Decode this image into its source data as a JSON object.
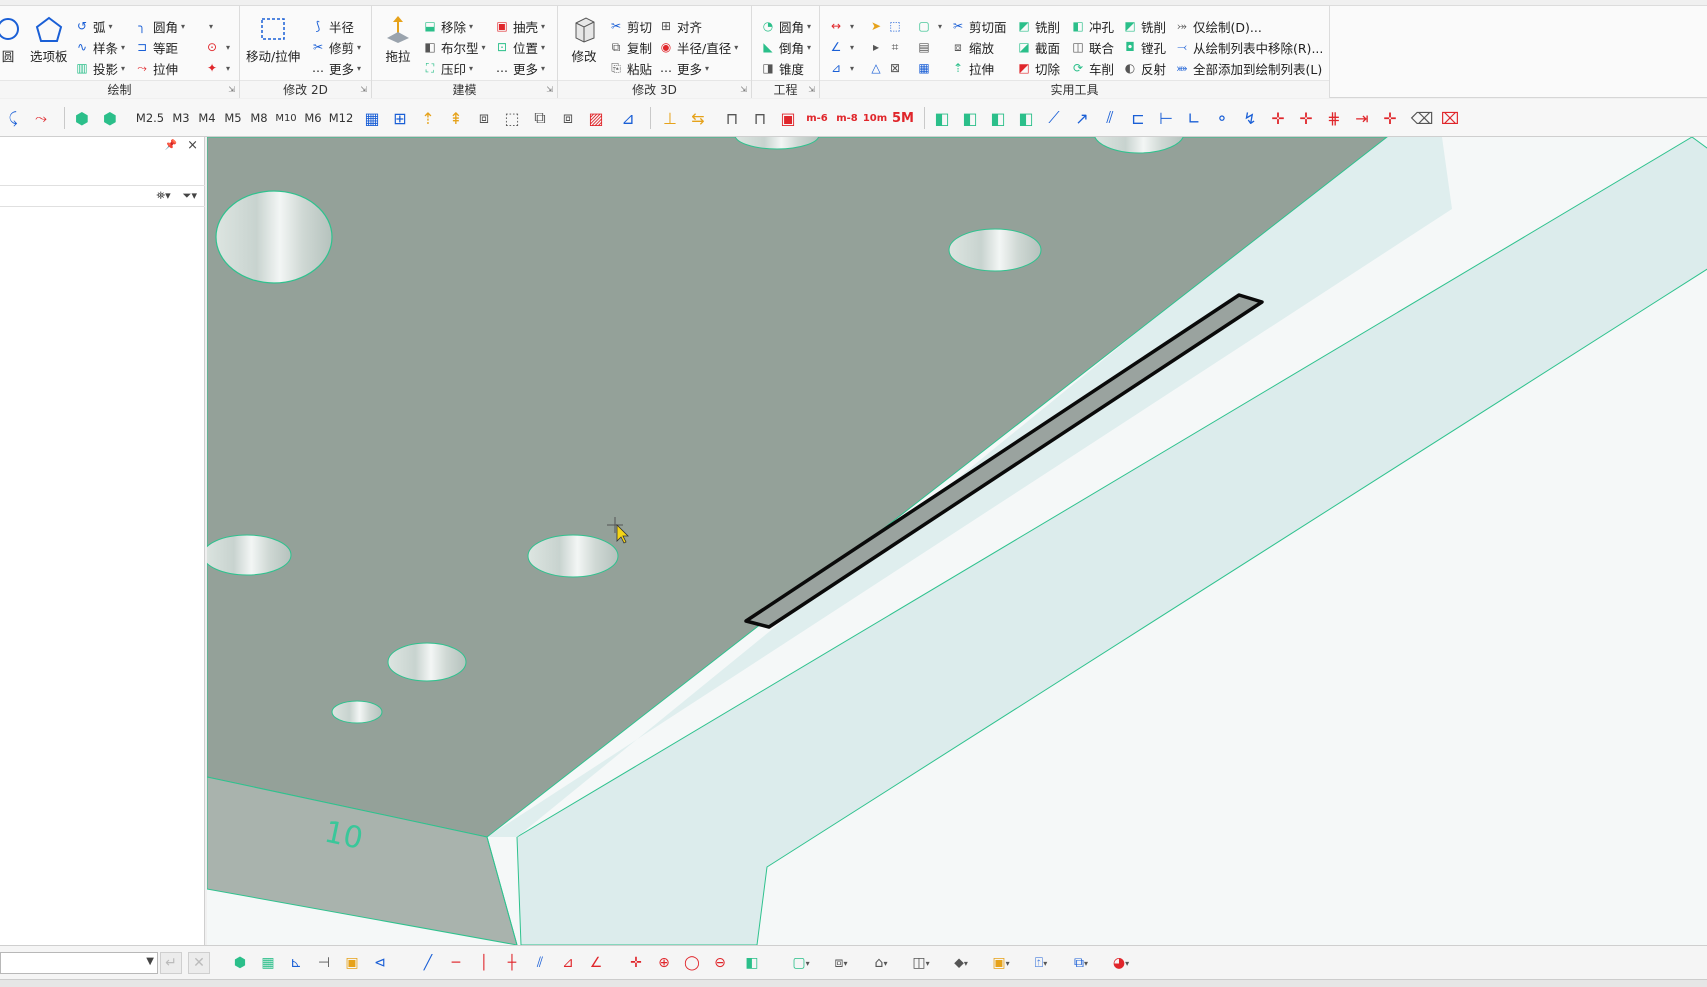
{
  "ribbon": {
    "groups": [
      {
        "title": "绘制"
      },
      {
        "title": "修改 2D"
      },
      {
        "title": "建模"
      },
      {
        "title": "修改 3D"
      },
      {
        "title": "工程"
      },
      {
        "title": "实用工具"
      }
    ],
    "draw": {
      "circle": "圆",
      "palette": "选项板",
      "arc": "弧",
      "spline": "样条",
      "project": "投影",
      "fillet": "圆角",
      "offset": "等距",
      "stretch": "拉伸"
    },
    "modify2d": {
      "move_stretch": "移动/拉伸",
      "radius": "半径",
      "trim": "修剪",
      "more": "更多"
    },
    "modeling": {
      "pull": "拖拉",
      "move": "移除",
      "boolean": "布尔型",
      "imprint": "压印",
      "shell": "抽壳",
      "position": "位置",
      "more": "更多"
    },
    "modify3d": {
      "modify": "修改",
      "cut": "剪切",
      "copy": "复制",
      "paste": "粘贴",
      "align": "对齐",
      "radius_diameter": "半径/直径",
      "more": "更多"
    },
    "engineering": {
      "fillet": "圆角",
      "chamfer": "倒角",
      "taper": "锥度"
    },
    "utilities": {
      "cut_plane": "剪切面",
      "scale": "缩放",
      "stretch": "拉伸",
      "mill": "铣削",
      "section": "截面",
      "cut": "切除",
      "punch": "冲孔",
      "union": "联合",
      "turn": "车削",
      "mill2": "铣削",
      "bore": "镗孔",
      "reverse": "反射",
      "draw_only": "仅绘制(D)...",
      "remove_from_list": "从绘制列表中移除(R)...",
      "add_all_to_list": "全部添加到绘制列表(L)"
    }
  },
  "toolbar2": {
    "thread_sizes": [
      "M2.5",
      "M3",
      "M4",
      "M5",
      "M8",
      "M10",
      "M6",
      "M12"
    ],
    "red_labels": [
      "m-6",
      "m-8",
      "10m",
      "5M"
    ]
  },
  "viewport": {
    "part_label": "10"
  },
  "colors": {
    "face_top": "#95a19a",
    "face_side": "#dfeeee",
    "edge": "#2fc28e",
    "accent_green": "#2bbf8a"
  }
}
